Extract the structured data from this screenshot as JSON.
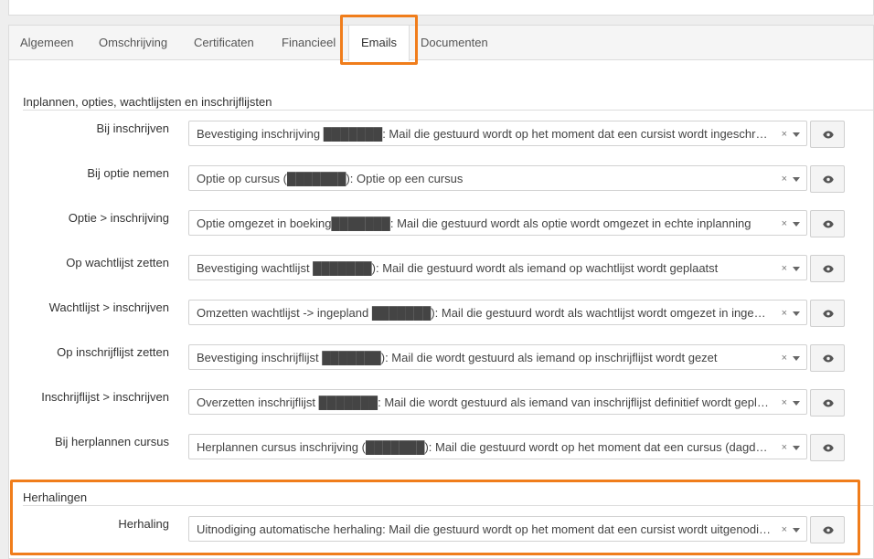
{
  "tabs": [
    {
      "label": "Algemeen"
    },
    {
      "label": "Omschrijving"
    },
    {
      "label": "Certificaten"
    },
    {
      "label": "Financieel"
    },
    {
      "label": "Emails"
    },
    {
      "label": "Documenten"
    }
  ],
  "sections": {
    "planning": {
      "title": "Inplannen, opties, wachtlijsten en inschrijflijsten",
      "rows": [
        {
          "label": "Bij inschrijven",
          "value": "Bevestiging inschrijving ███████: Mail die gestuurd wordt op het moment dat een cursist wordt ingeschreven voor een cursus"
        },
        {
          "label": "Bij optie nemen",
          "value": "Optie op cursus (███████): Optie op een cursus"
        },
        {
          "label": "Optie > inschrijving",
          "value": "Optie omgezet in boeking███████: Mail die gestuurd wordt als optie wordt omgezet in echte inplanning"
        },
        {
          "label": "Op wachtlijst zetten",
          "value": "Bevestiging wachtlijst ███████): Mail die gestuurd wordt als iemand op wachtlijst wordt geplaatst"
        },
        {
          "label": "Wachtlijst > inschrijven",
          "value": "Omzetten wachtlijst -> ingepland ███████): Mail die gestuurd wordt als wachtlijst wordt omgezet in ingepland"
        },
        {
          "label": "Op inschrijflijst zetten",
          "value": "Bevestiging inschrijflijst ███████): Mail die wordt gestuurd als iemand op inschrijflijst wordt gezet"
        },
        {
          "label": "Inschrijflijst > inschrijven",
          "value": "Overzetten inschrijflijst ███████: Mail die wordt gestuurd als iemand van inschrijflijst definitief wordt geplaatst"
        },
        {
          "label": "Bij herplannen cursus",
          "value": "Herplannen cursus inschrijving (███████): Mail die gestuurd wordt op het moment dat een cursus (dagdeel) wordt herpland"
        }
      ]
    },
    "repeats": {
      "title": "Herhalingen",
      "rows": [
        {
          "label": "Herhaling",
          "value": "Uitnodiging automatische herhaling: Mail die gestuurd wordt op het moment dat een cursist wordt uitgenodigd voor een herhaling"
        }
      ]
    }
  },
  "clear_glyph": "×",
  "icons": {
    "preview": "eye-icon",
    "dropdown": "caret-down-icon"
  },
  "colors": {
    "highlight": "#f07d1b"
  }
}
